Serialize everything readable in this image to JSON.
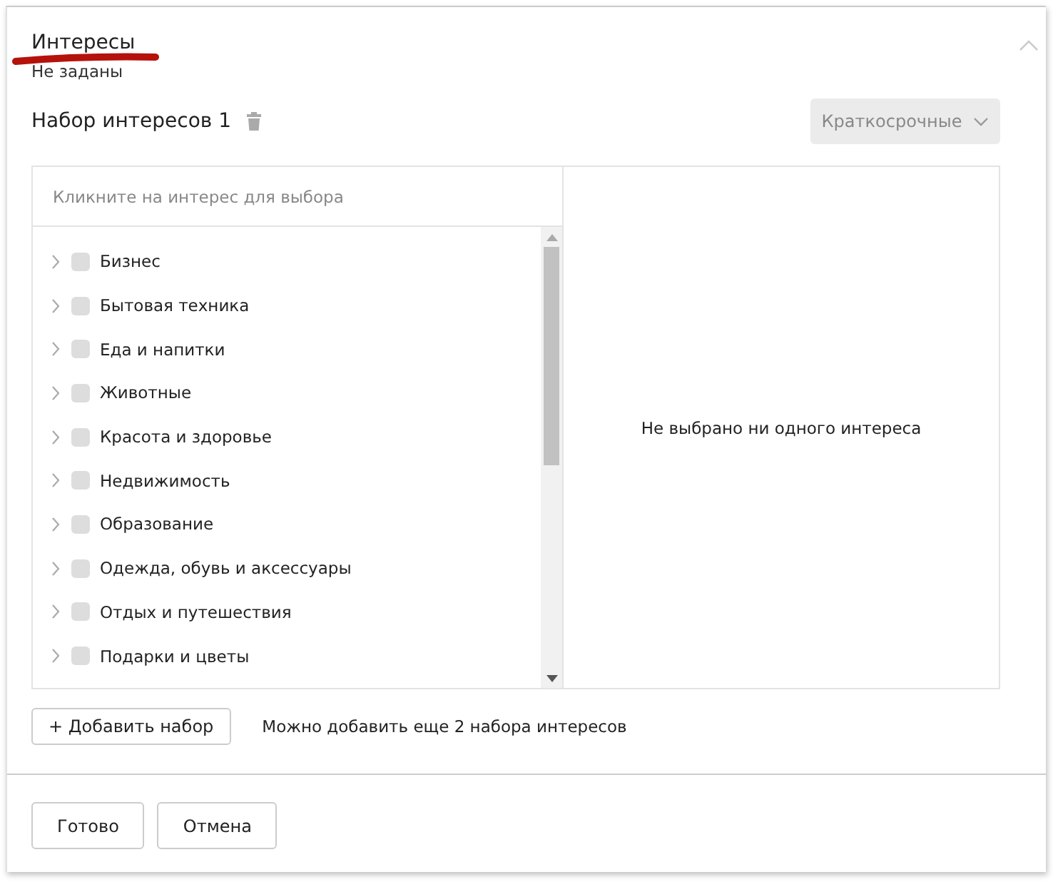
{
  "section": {
    "title": "Интересы",
    "value": "Не заданы",
    "expanded": true
  },
  "interest_set": {
    "title": "Набор интересов 1",
    "term_dropdown": "Краткосрочные"
  },
  "picker": {
    "placeholder": "Кликните на интерес для выбора",
    "empty_message": "Не выбрано ни одного интереса",
    "items": [
      {
        "label": "Бизнес",
        "expanded": false,
        "checked": false
      },
      {
        "label": "Бытовая техника",
        "expanded": false,
        "checked": false
      },
      {
        "label": "Еда и напитки",
        "expanded": false,
        "checked": false
      },
      {
        "label": "Животные",
        "expanded": false,
        "checked": false
      },
      {
        "label": "Красота и здоровье",
        "expanded": false,
        "checked": false
      },
      {
        "label": "Недвижимость",
        "expanded": false,
        "checked": false
      },
      {
        "label": "Образование",
        "expanded": false,
        "checked": false
      },
      {
        "label": "Одежда, обувь и аксессуары",
        "expanded": false,
        "checked": false
      },
      {
        "label": "Отдых и путешествия",
        "expanded": false,
        "checked": false
      },
      {
        "label": "Подарки и цветы",
        "expanded": false,
        "checked": false
      }
    ]
  },
  "add_set": {
    "button": "+ Добавить набор",
    "note": "Можно добавить еще 2 набора интересов"
  },
  "buttons": [
    "Готово",
    "Отмена"
  ]
}
